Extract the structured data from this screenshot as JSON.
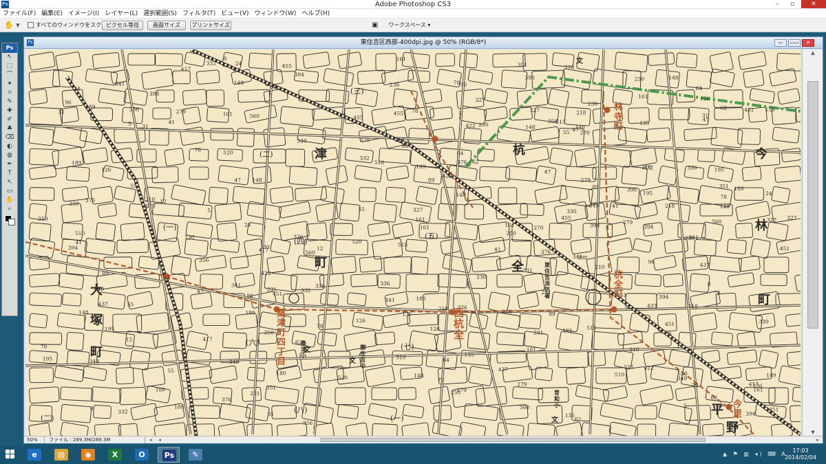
{
  "app": {
    "icon_label": "Ps",
    "title": "Adobe Photoshop CS3",
    "controls": {
      "minimize": "–",
      "maximize": "▫",
      "close": "✕"
    }
  },
  "menu": {
    "items": [
      "ファイル(F)",
      "編集(E)",
      "イメージ(I)",
      "レイヤー(L)",
      "選択範囲(S)",
      "フィルタ(T)",
      "ビュー(V)",
      "ウィンドウ(W)",
      "ヘルプ(H)"
    ]
  },
  "options_bar": {
    "tool_icon": "hand-tool-icon",
    "scroll_all_label": "すべてのウィンドウをスクロール",
    "actual_pixels": "ピクセル等倍",
    "fit_screen": "画面サイズ",
    "print_size": "プリントサイズ",
    "workspace_label": "ワークスペース ▾"
  },
  "tools": {
    "badge": "Ps",
    "glyphs": [
      "↖",
      "⬚",
      "⌒",
      "✦",
      "⌗",
      "✎",
      "✚",
      "✐",
      "♣",
      "⌫",
      "◐",
      "◍",
      "✒",
      "T",
      "↖",
      "▭",
      "✋",
      "⌕"
    ]
  },
  "document": {
    "icon_label": "Ps",
    "title": "東住吉区西部-400dpi.jpg @ 50% (RGB/8*)",
    "zoom": "50%",
    "file_info": "ファイル : 289.3M/289.3M",
    "controls": {
      "minimize": "▭",
      "restore": "▭▭",
      "close": "✕"
    }
  },
  "map": {
    "colors": {
      "paper": "#f4e8c6",
      "ink": "#2c2a26",
      "route": "#b4582c",
      "park": "#4a9a4e"
    },
    "district_labels": [
      "大",
      "塚",
      "町",
      "津",
      "町",
      "杭",
      "全",
      "今",
      "林",
      "町",
      "平",
      "野",
      "文",
      "文",
      "文",
      "文"
    ],
    "station_labels": [
      "西杭全",
      "杭全町",
      "林寺町",
      "今里",
      "桑津町四丁目",
      "東住吉消防署",
      "東住吉中",
      "育和小",
      "桑津小"
    ],
    "section_numbers": [
      "(一)",
      "(二)",
      "(三)",
      "(四)",
      "(五)",
      "(六)",
      "(七)",
      "(八)",
      "(二)",
      "(一)"
    ],
    "block_numbers": [
      "341",
      "336",
      "349",
      "351",
      "356",
      "398",
      "394",
      "376",
      "327",
      "330",
      "332",
      "270",
      "279",
      "250",
      "231",
      "230",
      "218",
      "210",
      "189",
      "180",
      "161",
      "148",
      "135",
      "126",
      "96",
      "89",
      "78",
      "62",
      "55",
      "47",
      "31",
      "24",
      "12",
      "8",
      "5",
      "417",
      "422",
      "437",
      "451",
      "455",
      "510",
      "515",
      "520",
      "560",
      "195",
      "161",
      "148",
      "79",
      "64",
      "41"
    ]
  },
  "taskbar": {
    "apps": [
      "e",
      "▤",
      "◉",
      "X",
      "O",
      "Ps",
      "✎"
    ],
    "tray_icons": "▲ ⚑ ▥ ◂) ⌨ A",
    "time": "17:03",
    "date": "2014/02/04"
  }
}
